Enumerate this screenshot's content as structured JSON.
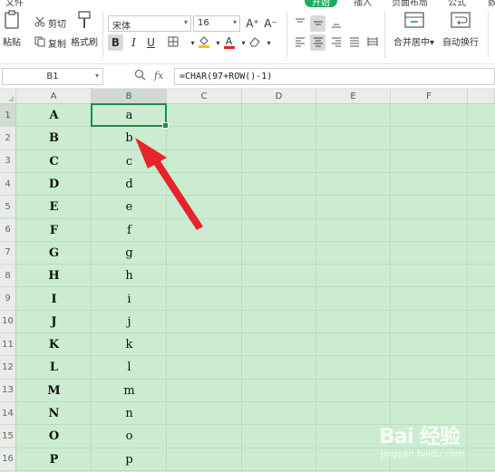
{
  "tabs": [
    {
      "label": "文件"
    },
    {
      "label": "开始",
      "active": true
    },
    {
      "label": "插入"
    },
    {
      "label": "页面布局"
    },
    {
      "label": "公式"
    },
    {
      "label": "数"
    }
  ],
  "ribbon": {
    "paste_label": "粘贴",
    "cut_label": "剪切",
    "copy_label": "复制",
    "format_painter_label": "格式刷",
    "font_name": "宋体",
    "font_size": "16",
    "grow_font": "A⁺",
    "shrink_font": "A⁻",
    "bold": "B",
    "italic": "I",
    "underline": "U",
    "font_color_glyph": "A",
    "merge_center_label": "合并居中",
    "wrap_text_label": "自动换行"
  },
  "formula_bar": {
    "name_box": "B1",
    "fx": "fx",
    "formula": "=CHAR(97+ROW()-1)"
  },
  "grid": {
    "columns": [
      "A",
      "B",
      "C",
      "D",
      "E",
      "F"
    ],
    "selected_column": "B",
    "rows": [
      {
        "n": "1",
        "a": "A",
        "b": "a"
      },
      {
        "n": "2",
        "a": "B",
        "b": "b"
      },
      {
        "n": "3",
        "a": "C",
        "b": "c"
      },
      {
        "n": "4",
        "a": "D",
        "b": "d"
      },
      {
        "n": "5",
        "a": "E",
        "b": "e"
      },
      {
        "n": "6",
        "a": "F",
        "b": "f"
      },
      {
        "n": "7",
        "a": "G",
        "b": "g"
      },
      {
        "n": "8",
        "a": "H",
        "b": "h"
      },
      {
        "n": "9",
        "a": "I",
        "b": "i"
      },
      {
        "n": "10",
        "a": "J",
        "b": "j"
      },
      {
        "n": "11",
        "a": "K",
        "b": "k"
      },
      {
        "n": "12",
        "a": "L",
        "b": "l"
      },
      {
        "n": "13",
        "a": "M",
        "b": "m"
      },
      {
        "n": "14",
        "a": "N",
        "b": "n"
      },
      {
        "n": "15",
        "a": "O",
        "b": "o"
      },
      {
        "n": "16",
        "a": "P",
        "b": "p"
      }
    ]
  },
  "colors": {
    "sheet_background": "#cbecd0",
    "accent_green": "#1dac5c",
    "arrow_red": "#e8232a"
  },
  "watermark": {
    "main": "Bai 经验",
    "sub": "jingyan.baidu.com"
  }
}
